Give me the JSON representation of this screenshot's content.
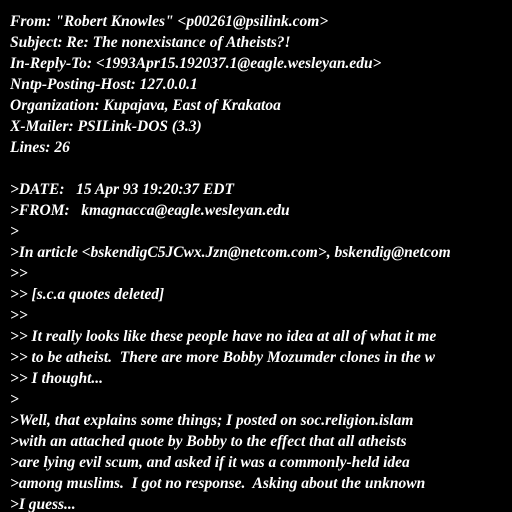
{
  "headers": {
    "from": "From: \"Robert Knowles\" <p00261@psilink.com>",
    "subject": "Subject: Re: The nonexistance of Atheists?!",
    "in_reply_to": "In-Reply-To: <1993Apr15.192037.1@eagle.wesleyan.edu>",
    "nntp_host": "Nntp-Posting-Host: 127.0.0.1",
    "organization": "Organization: Kupajava, East of Krakatoa",
    "mailer": "X-Mailer: PSILink-DOS (3.3)",
    "lines": "Lines: 26"
  },
  "body": {
    "date": ">DATE:   15 Apr 93 19:20:37 EDT",
    "from": ">FROM:   kmagnacca@eagle.wesleyan.edu",
    "q1": ">",
    "q2": ">In article <bskendigC5JCwx.Jzn@netcom.com>, bskendig@netcom",
    "q3": ">>",
    "q4": ">> [s.c.a quotes deleted]",
    "q5": ">>",
    "q6": ">> It really looks like these people have no idea at all of what it me",
    "q7": ">> to be atheist.  There are more Bobby Mozumder clones in the w",
    "q8": ">> I thought...",
    "q9": ">",
    "q10": ">Well, that explains some things; I posted on soc.religion.islam",
    "q11": ">with an attached quote by Bobby to the effect that all atheists",
    "q12": ">are lying evil scum, and asked if it was a commonly-held idea",
    "q13": ">among muslims.  I got no response.  Asking about the unknown",
    "q14": ">I guess..."
  }
}
